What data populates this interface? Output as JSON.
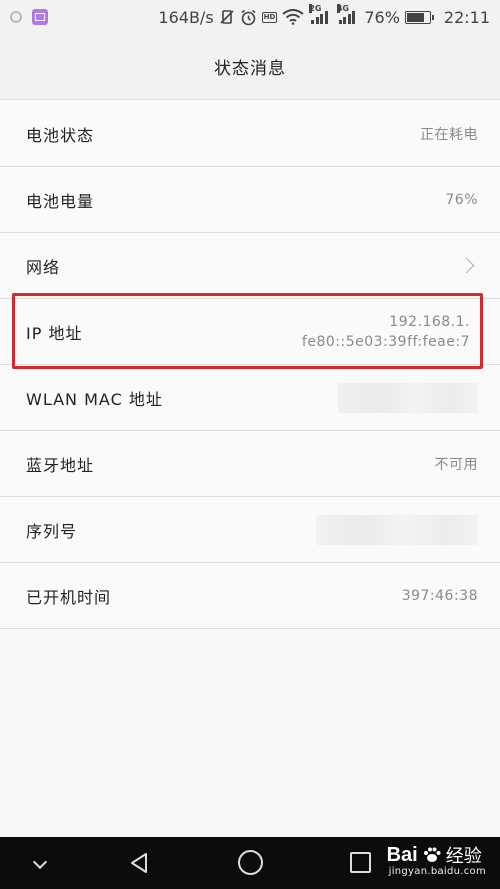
{
  "status_bar": {
    "speed": "164B/s",
    "network_2g": "2G",
    "network_4g": "4G",
    "hd_label": "HD",
    "battery_percent": "76%",
    "battery_level": 0.76,
    "time": "22:11"
  },
  "header": {
    "title": "状态消息"
  },
  "rows": [
    {
      "label": "电池状态",
      "value": "正在耗电"
    },
    {
      "label": "电池电量",
      "value": "76%"
    },
    {
      "label": "网络",
      "value": ""
    },
    {
      "label": "IP 地址",
      "value_line1": "192.168.1.",
      "value_line2": "fe80::5e03:39ff:feae:7"
    },
    {
      "label": "WLAN MAC 地址",
      "value": ""
    },
    {
      "label": "蓝牙地址",
      "value": "不可用"
    },
    {
      "label": "序列号",
      "value": ""
    },
    {
      "label": "已开机时间",
      "value": "397:46:38"
    }
  ],
  "watermark": {
    "brand": "Bai",
    "brand_cn": "经验",
    "url": "jingyan.baidu.com"
  },
  "colors": {
    "highlight": "#d42a2a",
    "navbar": "#0c0c0c"
  }
}
